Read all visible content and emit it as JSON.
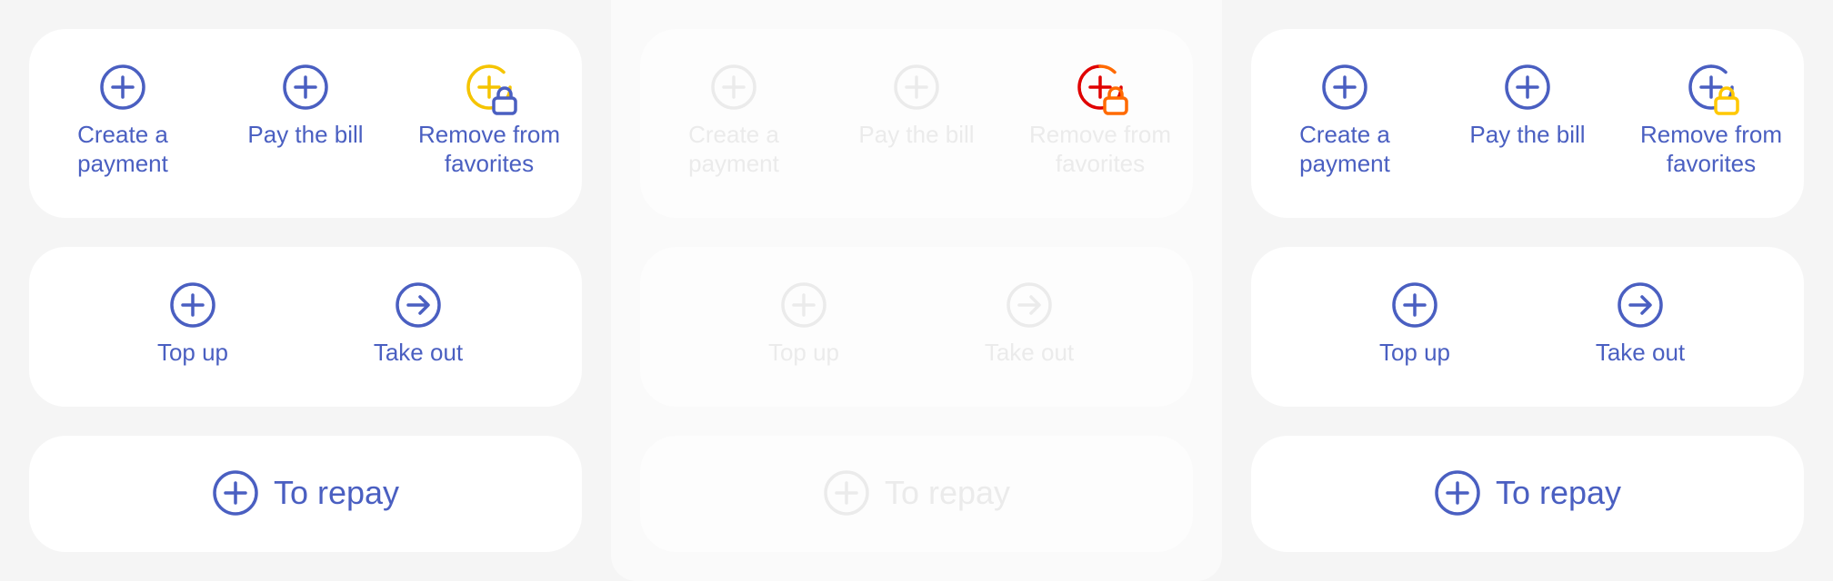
{
  "colors": {
    "primary": "#4a5fc1",
    "disabled": "#ebebeb",
    "lock_yellow": "#f5c400",
    "lock_red": "#e00000",
    "lock_orange": "#ff6a00",
    "lock_blue": "#4a5fc1",
    "lock_gold": "#ffc800"
  },
  "icons": {
    "plus": "plus-circle-icon",
    "arrow": "arrow-right-circle-icon",
    "lock": "lock-icon"
  },
  "panels": [
    {
      "state": "default",
      "top_actions": [
        {
          "label": "Create a\npayment"
        },
        {
          "label": "Pay the bill"
        },
        {
          "label": "Remove from\nfavorites"
        }
      ],
      "mid_actions": [
        {
          "label": "Top up"
        },
        {
          "label": "Take out"
        }
      ],
      "bottom_action": {
        "label": "To repay"
      }
    },
    {
      "state": "disabled",
      "top_actions": [
        {
          "label": "Create a\npayment"
        },
        {
          "label": "Pay the bill"
        },
        {
          "label": "Remove from\nfavorites"
        }
      ],
      "mid_actions": [
        {
          "label": "Top up"
        },
        {
          "label": "Take out"
        }
      ],
      "bottom_action": {
        "label": "To repay"
      }
    },
    {
      "state": "default",
      "top_actions": [
        {
          "label": "Create a\npayment"
        },
        {
          "label": "Pay the bill"
        },
        {
          "label": "Remove from\nfavorites"
        }
      ],
      "mid_actions": [
        {
          "label": "Top up"
        },
        {
          "label": "Take out"
        }
      ],
      "bottom_action": {
        "label": "To repay"
      }
    }
  ]
}
